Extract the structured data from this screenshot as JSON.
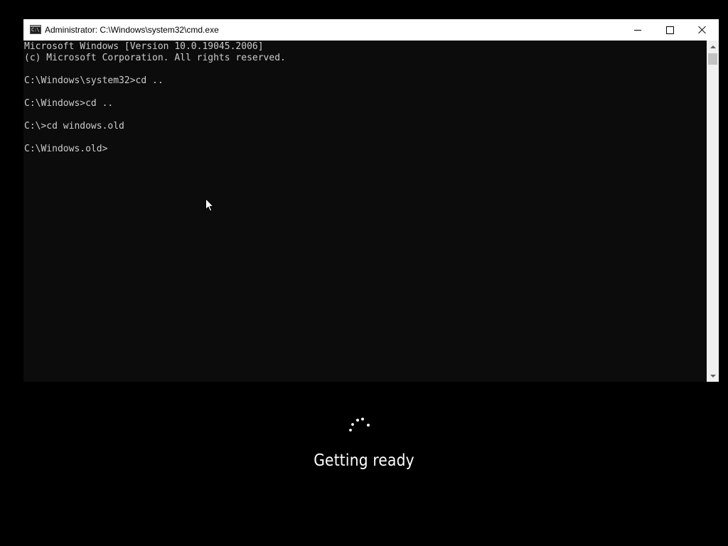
{
  "window": {
    "title": "Administrator: C:\\Windows\\system32\\cmd.exe",
    "icon": "cmd-icon",
    "icon_glyph": "C:\\",
    "controls": {
      "minimize": "minimize-icon",
      "maximize": "maximize-icon",
      "close": "close-icon"
    }
  },
  "console": {
    "lines": [
      "Microsoft Windows [Version 10.0.19045.2006]",
      "(c) Microsoft Corporation. All rights reserved.",
      "",
      "C:\\Windows\\system32>cd ..",
      "",
      "C:\\Windows>cd ..",
      "",
      "C:\\>cd windows.old",
      "",
      "C:\\Windows.old>"
    ],
    "text_color": "#cccccc",
    "background_color": "#0c0c0c"
  },
  "scrollbar": {
    "up_arrow": "chevron-up-icon",
    "down_arrow": "chevron-down-icon"
  },
  "overlay": {
    "status_text": "Getting ready",
    "spinner_icon": "loading-spinner-icon"
  },
  "colors": {
    "screen_background": "#000000",
    "title_bar": "#ffffff",
    "status_text": "#ffffff"
  }
}
